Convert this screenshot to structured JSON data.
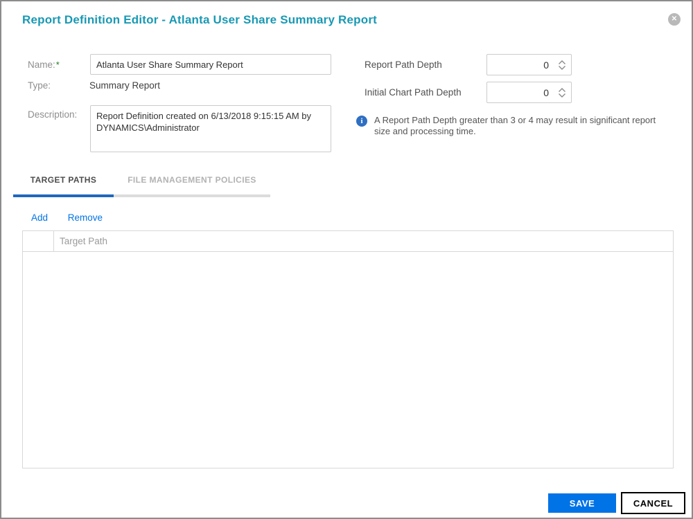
{
  "dialog": {
    "title": "Report Definition Editor - Atlanta User Share Summary Report",
    "close_icon": "close-x"
  },
  "form": {
    "name": {
      "label": "Name:",
      "required_mark": "*",
      "value": "Atlanta User Share Summary Report"
    },
    "type": {
      "label": "Type:",
      "value": "Summary Report"
    },
    "description": {
      "label": "Description:",
      "value": "Report Definition created on 6/13/2018 9:15:15 AM by DYNAMICS\\Administrator"
    },
    "report_path_depth": {
      "label": "Report Path Depth",
      "value": "0"
    },
    "initial_chart_path_depth": {
      "label": "Initial Chart Path Depth",
      "value": "0"
    },
    "note": "A Report Path Depth greater than 3 or 4 may result in significant report size and processing time."
  },
  "tabs": [
    {
      "label": "TARGET PATHS",
      "active": true
    },
    {
      "label": "FILE MANAGEMENT POLICIES",
      "active": false
    }
  ],
  "toolbar": {
    "add_label": "Add",
    "remove_label": "Remove"
  },
  "table": {
    "columns": [
      "",
      "Target Path"
    ],
    "rows": []
  },
  "footer": {
    "save_label": "SAVE",
    "cancel_label": "CANCEL"
  },
  "icons": {
    "close": "close-icon",
    "info": "info-icon",
    "spinner": "spinner-arrows-icon"
  },
  "colors": {
    "title_teal": "#1899b4",
    "link_blue": "#0073e7",
    "tab_underline_blue": "#1f68bd",
    "save_button_blue": "#0073e7",
    "info_icon_blue": "#2f6fc3",
    "required_green": "#1e7d1e",
    "dialog_border_gray": "#8c8c8c"
  }
}
